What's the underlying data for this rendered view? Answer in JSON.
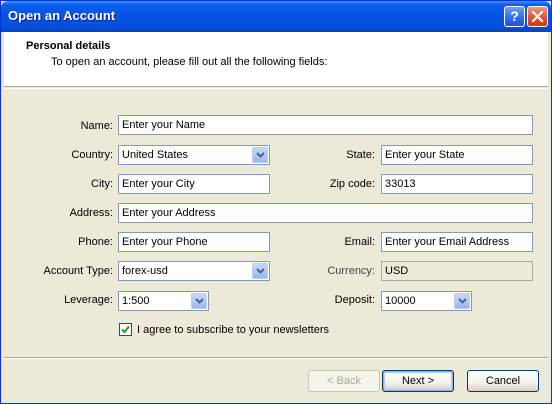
{
  "window": {
    "title": "Open an Account"
  },
  "header": {
    "title": "Personal details",
    "subtitle": "To open an account, please fill out all the following fields:"
  },
  "form": {
    "name": {
      "label": "Name:",
      "value": "Enter your Name"
    },
    "country": {
      "label": "Country:",
      "value": "United States"
    },
    "state": {
      "label": "State:",
      "value": "Enter your State"
    },
    "city": {
      "label": "City:",
      "value": "Enter your City"
    },
    "zip": {
      "label": "Zip code:",
      "value": "33013"
    },
    "address": {
      "label": "Address:",
      "value": "Enter your Address"
    },
    "phone": {
      "label": "Phone:",
      "value": "Enter your Phone"
    },
    "email": {
      "label": "Email:",
      "value": "Enter your Email Address"
    },
    "account_type": {
      "label": "Account Type:",
      "value": "forex-usd"
    },
    "currency": {
      "label": "Currency:",
      "value": "USD"
    },
    "leverage": {
      "label": "Leverage:",
      "value": "1:500"
    },
    "deposit": {
      "label": "Deposit:",
      "value": "10000"
    },
    "newsletter": {
      "label": "I agree to subscribe to your newsletters",
      "checked": true
    }
  },
  "buttons": {
    "back": "< Back",
    "next": "Next >",
    "cancel": "Cancel"
  },
  "colors": {
    "titlebar": "#0454E4",
    "dialog_bg": "#ECE9D8",
    "field_border": "#7F9DB9"
  }
}
